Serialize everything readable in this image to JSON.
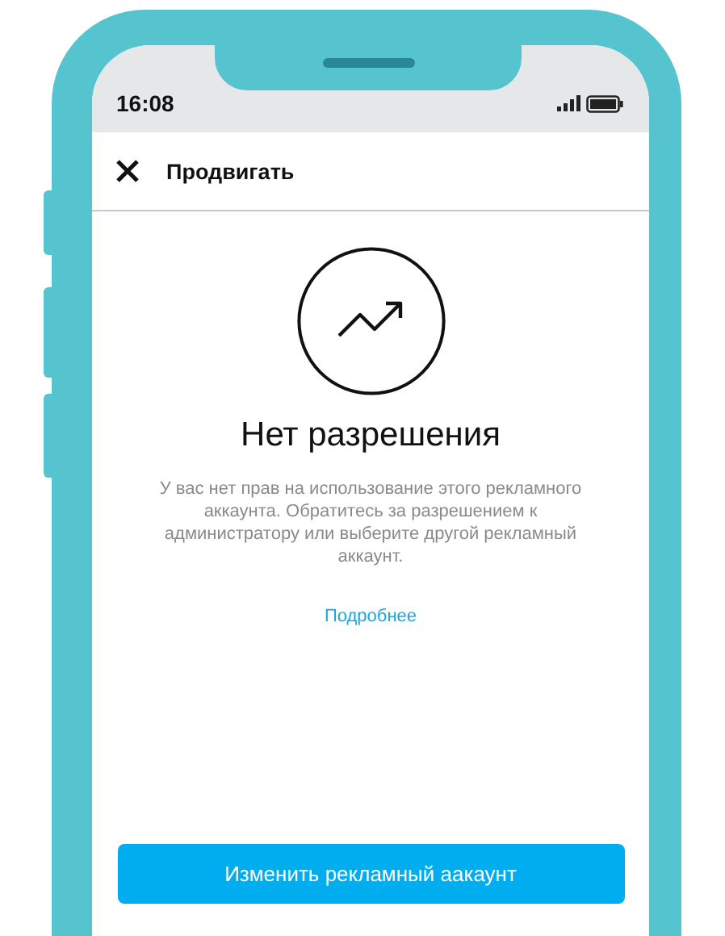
{
  "status_bar": {
    "time": "16:08"
  },
  "header": {
    "title": "Продвигать"
  },
  "message": {
    "title": "Нет разрешения",
    "body": "У вас нет прав на использование этого рекламного аккаунта. Обратитесь за разрешением к администратору или выберите другой рекламный аккаунт.",
    "link": "Подробнее"
  },
  "primary_button": {
    "label": "Изменить рекламный аакаунт"
  }
}
